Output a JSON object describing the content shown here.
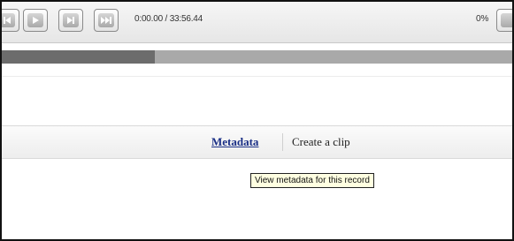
{
  "player": {
    "buttons": [
      {
        "icon": "previous-icon"
      },
      {
        "icon": "play-icon"
      },
      {
        "icon": "step-forward-icon"
      },
      {
        "icon": "fast-forward-icon"
      }
    ],
    "time_display": "0:00.00 / 33:56.44",
    "volume_percent": "0%",
    "progress_fraction": 0.3
  },
  "toolbar": {
    "metadata_label": "Metadata",
    "create_clip_label": "Create a clip"
  },
  "tooltip": {
    "text": "View metadata for this record"
  },
  "colors": {
    "link": "#1a2f86",
    "tooltip_bg": "#ffffe1",
    "progress_fill": "#6c6c6c",
    "progress_track": "#a9a9a9"
  }
}
